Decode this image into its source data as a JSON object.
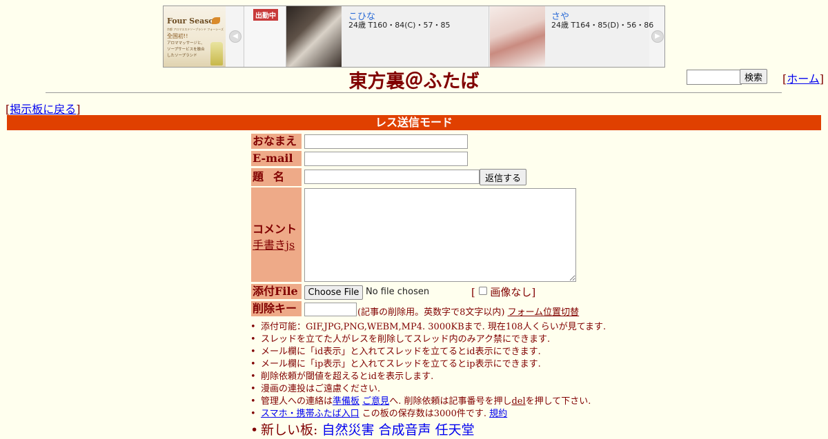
{
  "banner": {
    "logo": {
      "brand": "Four Season",
      "tagline_small": "京都 アロマエステソープランド フォーシーズン",
      "headline": "全国初!!",
      "description": "アロママッサージと、ソープサービスを融合したソープランド"
    },
    "on_duty_label": "出勤中",
    "cards": [
      {
        "name": "こひな",
        "spec": "24歳 T160・84(C)・57・85"
      },
      {
        "name": "さや",
        "spec": "24歳 T164・85(D)・56・86"
      }
    ],
    "prev_icon": "chevron-left-icon",
    "next_icon": "chevron-right-icon"
  },
  "header": {
    "title": "東方裏＠ふたば",
    "search_button": "検索",
    "home_link": "ホーム",
    "back_link": "掲示板に戻る"
  },
  "mode_bar": "レス送信モード",
  "form": {
    "name_label": "おなまえ",
    "email_label": "E-mail",
    "subject_label": "題名",
    "reply_button": "返信する",
    "comment_label": "コメント",
    "handwrite_link": "手書きjs",
    "file_label": "添付File",
    "file_button": "Choose File",
    "file_status": "No file chosen",
    "noimage_label": "画像なし",
    "delkey_label": "削除キー",
    "delkey_note": "(記事の削除用。英数字で8文字以内)",
    "form_switch_link": "フォーム位置切替"
  },
  "notes": {
    "n1": "添付可能：GIF,JPG,PNG,WEBM,MP4. 3000KBまで. 現在108人くらいが見てます.",
    "n2": "スレッドを立てた人がレスを削除してスレッド内のみアク禁にできます.",
    "n3": "メール欄に「id表示」と入れてスレッドを立てるとid表示にできます.",
    "n4": "メール欄に「ip表示」と入れてスレッドを立てるとip表示にできます.",
    "n5": "削除依頼が閾値を超えるとidを表示します.",
    "n6": "漫画の連投はご遠慮ください.",
    "n7_a": "管理人への連絡は",
    "n7_link1": "準備板",
    "n7_link2": "ご意見",
    "n7_b": "へ. 削除依頼は記事番号を押し",
    "n7_del": "del",
    "n7_c": "を押して下さい.",
    "n8_link": "スマホ・携帯ふたば入口",
    "n8_text": "この板の保存数は3000件です.",
    "n8_rules": "規約",
    "n9_label": "新しい板:",
    "n9_links": [
      "自然災害",
      "合成音声",
      "任天堂"
    ]
  },
  "colors": {
    "background": "#ffffee",
    "text": "#800000",
    "label_bg": "#eeaa88",
    "mode_bar": "#e04000",
    "link": "#0000ee"
  }
}
